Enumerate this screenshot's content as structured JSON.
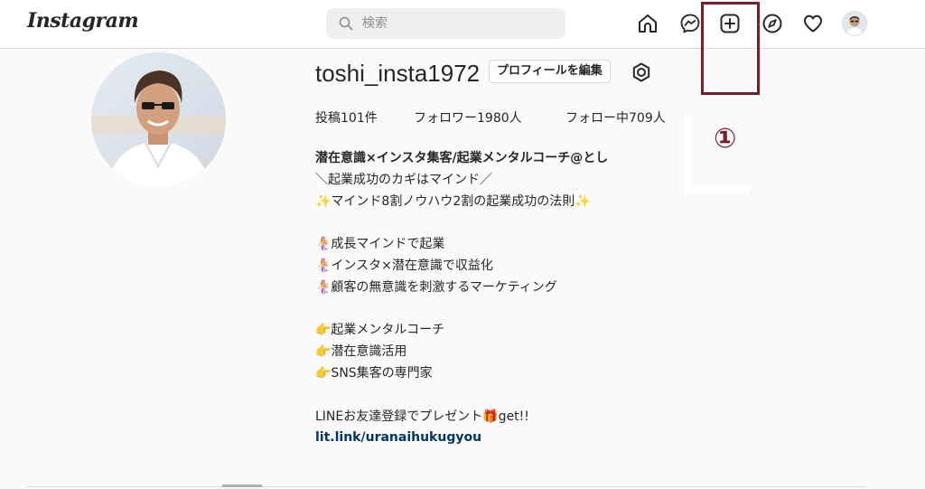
{
  "header": {
    "logo": "Instagram",
    "search_placeholder": "検索",
    "nav_icons": [
      "home-icon",
      "messenger-icon",
      "new-post-icon",
      "explore-icon",
      "activity-heart-icon",
      "profile-avatar"
    ]
  },
  "annotation": {
    "label": "①",
    "color": "#7a1e2c"
  },
  "profile": {
    "username": "toshi_insta1972",
    "edit_button": "プロフィールを編集",
    "stats": {
      "posts": "投稿101件",
      "followers": "フォロワー1980人",
      "following": "フォロー中709人"
    },
    "bio": {
      "name": "潜在意識×インスタ集客/起業メンタルコーチ@とし",
      "lines": [
        "＼起業成功のカギはマインド／",
        "✨マインド8割ノウハウ2割の起業成功の法則✨",
        "",
        "🧜‍♀️成長マインドで起業",
        "🧜‍♀️インスタ×潜在意識で収益化",
        "🧜‍♀️顧客の無意識を刺激するマーケティング",
        "",
        "👉起業メンタルコーチ",
        "👉潜在意識活用",
        "👉SNS集客の専門家",
        "",
        "LINEお友達登録でプレゼント🎁get!!"
      ],
      "link": "lit.link/uranaihukugyou"
    }
  },
  "colors": {
    "background": "#fafafa",
    "header_bg": "#ffffff",
    "link": "#00376b",
    "annotation": "#7a1e2c"
  }
}
